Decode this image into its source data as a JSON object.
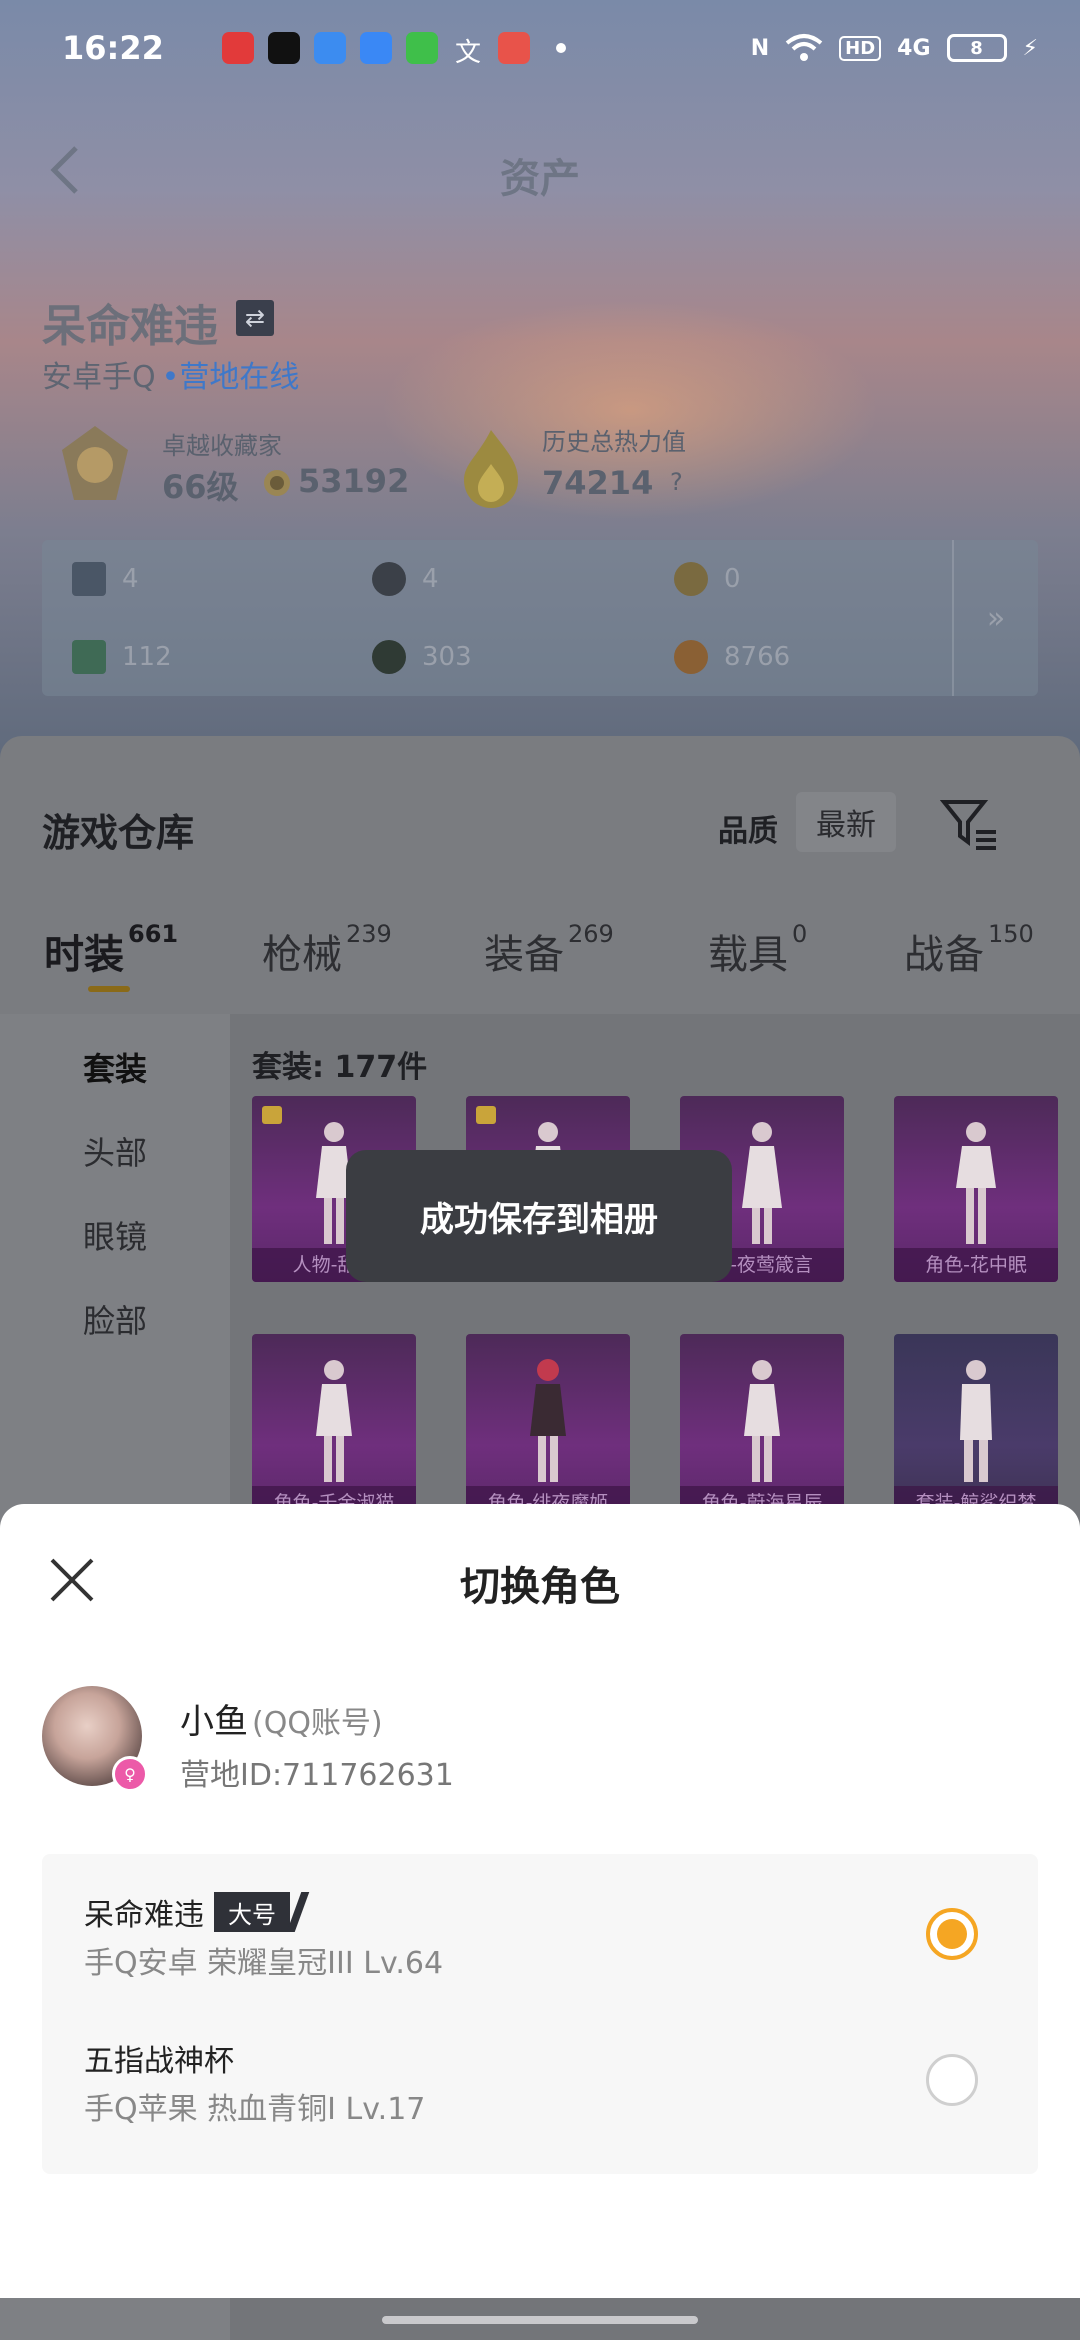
{
  "status_bar": {
    "time": "16:22",
    "network": "HD",
    "signal": "4G",
    "battery": "8"
  },
  "header": {
    "title": "资产"
  },
  "profile": {
    "name": "呆命难违",
    "platform": "安卓手Q",
    "status": "营地在线",
    "collector_title": "卓越收藏家",
    "collector_level": "66级",
    "collector_points": "53192",
    "heat_label": "历史总热力值",
    "heat_value": "74214",
    "heat_help": "?"
  },
  "resources": [
    {
      "icon": "card-icon",
      "value": "4"
    },
    {
      "icon": "coin-icon",
      "value": "4"
    },
    {
      "icon": "medal-icon",
      "value": "0"
    },
    {
      "icon": "ticket-icon",
      "value": "112"
    },
    {
      "icon": "orb-icon",
      "value": "303"
    },
    {
      "icon": "gold-icon",
      "value": "8766"
    }
  ],
  "resources_more": "»",
  "warehouse": {
    "title": "游戏仓库",
    "quality_label": "品质",
    "sort_label": "最新",
    "tabs": [
      {
        "label": "时装",
        "count": "661"
      },
      {
        "label": "枪械",
        "count": "239"
      },
      {
        "label": "装备",
        "count": "269"
      },
      {
        "label": "载具",
        "count": "0"
      },
      {
        "label": "战备",
        "count": "150"
      }
    ],
    "side_items": [
      "套装",
      "头部",
      "眼镜",
      "脸部"
    ],
    "set_count": "套装: 177件",
    "cards": [
      {
        "label": "人物-甜心"
      },
      {
        "label": ""
      },
      {
        "label": "色-夜莺箴言"
      },
      {
        "label": "角色-花中眠"
      },
      {
        "label": "角色-千金淑猫"
      },
      {
        "label": "角色-绯夜魔姬"
      },
      {
        "label": "角色-蔚海星辰"
      },
      {
        "label": "套装-鲸鲨织梦"
      }
    ]
  },
  "toast": {
    "message": "成功保存到相册"
  },
  "switch_sheet": {
    "title": "切换角色",
    "account_name": "小鱼",
    "account_type": "(QQ账号)",
    "camp_id": "营地ID:711762631",
    "roles": [
      {
        "name": "呆命难违",
        "tag": "大号",
        "meta": "手Q安卓  荣耀皇冠III  Lv.64",
        "selected": true
      },
      {
        "name": "五指战神杯",
        "tag": "",
        "meta": "手Q苹果  热血青铜I  Lv.17",
        "selected": false
      }
    ]
  },
  "colors": {
    "accent": "#f5a623",
    "online": "#3f78c9",
    "toast_bg": "#3b3d42"
  }
}
